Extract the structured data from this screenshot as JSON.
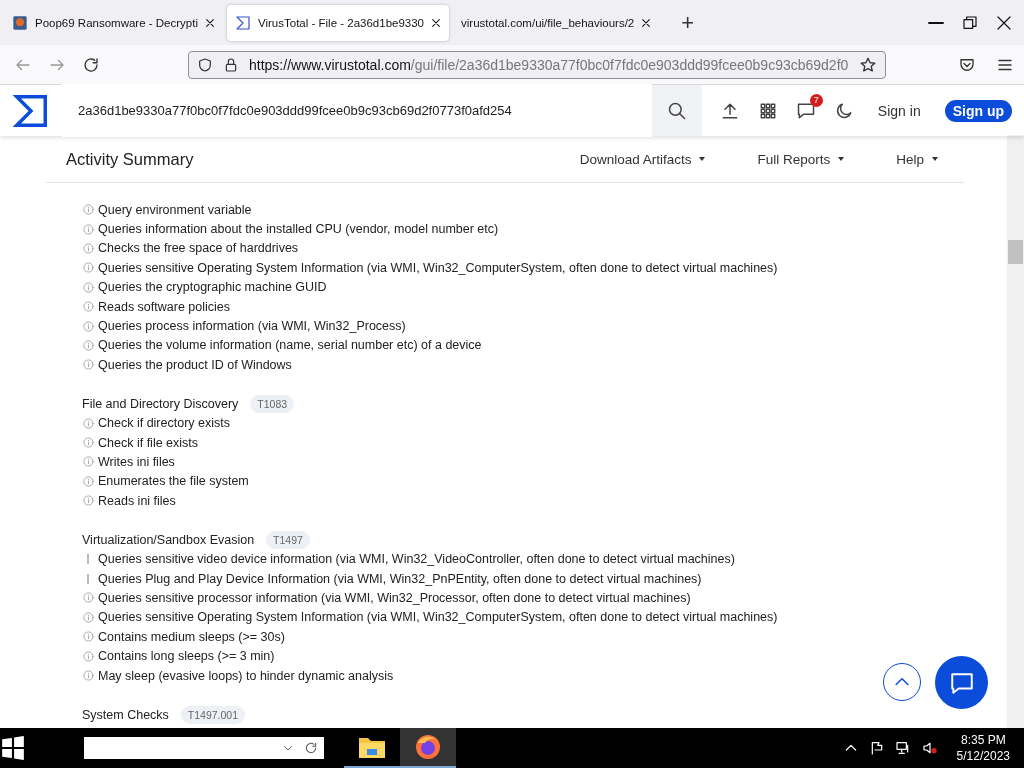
{
  "browser": {
    "tabs": [
      {
        "title": "Poop69 Ransomware - Decrypti",
        "selected": false
      },
      {
        "title": "VirusTotal - File - 2a36d1be9330",
        "selected": true
      },
      {
        "title": "virustotal.com/ui/file_behaviours/2",
        "selected": false
      }
    ],
    "new_tab": "+",
    "url_host": "https://www.virustotal.com",
    "url_path": "/gui/file/2a36d1be9330a77f0bc0f7fdc0e903ddd99fcee0b9c93cb69d2f0"
  },
  "header": {
    "search_value": "2a36d1be9330a77f0bc0f7fdc0e903ddd99fcee0b9c93cb69d2f0773f0afd254",
    "notifications": "7",
    "sign_in": "Sign in",
    "sign_up": "Sign up"
  },
  "subheader": {
    "title": "Activity Summary",
    "menus": [
      "Download Artifacts",
      "Full Reports",
      "Help"
    ]
  },
  "sections": [
    {
      "items": [
        {
          "kind": "info",
          "text": "Query environment variable"
        },
        {
          "kind": "info",
          "text": "Queries information about the installed CPU (vendor, model number etc)"
        },
        {
          "kind": "info",
          "text": "Checks the free space of harddrives"
        },
        {
          "kind": "info",
          "text": "Queries sensitive Operating System Information (via WMI, Win32_ComputerSystem, often done to detect virtual machines)"
        },
        {
          "kind": "info",
          "text": "Queries the cryptographic machine GUID"
        },
        {
          "kind": "info",
          "text": "Reads software policies"
        },
        {
          "kind": "info",
          "text": "Queries process information (via WMI, Win32_Process)"
        },
        {
          "kind": "info",
          "text": "Queries the volume information (name, serial number etc) of a device"
        },
        {
          "kind": "info",
          "text": "Queries the product ID of Windows"
        }
      ]
    },
    {
      "title": "File and Directory Discovery",
      "tag": "T1083",
      "items": [
        {
          "kind": "info",
          "text": "Check if directory exists"
        },
        {
          "kind": "info",
          "text": "Check if file exists"
        },
        {
          "kind": "info",
          "text": "Writes ini files"
        },
        {
          "kind": "info",
          "text": "Enumerates the file system"
        },
        {
          "kind": "info",
          "text": "Reads ini files"
        }
      ]
    },
    {
      "title": "Virtualization/Sandbox Evasion",
      "tag": "T1497",
      "items": [
        {
          "kind": "warning",
          "text": "Queries sensitive video device information (via WMI, Win32_VideoController, often done to detect virtual machines)"
        },
        {
          "kind": "warning",
          "text": "Queries Plug and Play Device Information (via WMI, Win32_PnPEntity, often done to detect virtual machines)"
        },
        {
          "kind": "info",
          "text": "Queries sensitive processor information (via WMI, Win32_Processor, often done to detect virtual machines)"
        },
        {
          "kind": "info",
          "text": "Queries sensitive Operating System Information (via WMI, Win32_ComputerSystem, often done to detect virtual machines)"
        },
        {
          "kind": "info",
          "text": "Contains medium sleeps (>= 30s)"
        },
        {
          "kind": "info",
          "text": "Contains long sleeps (>= 3 min)"
        },
        {
          "kind": "info",
          "text": "May sleep (evasive loops) to hinder dynamic analysis"
        }
      ]
    },
    {
      "title": "System Checks",
      "tag": "T1497.001"
    }
  ],
  "taskbar": {
    "time": "8:35 PM",
    "date": "5/12/2023"
  }
}
